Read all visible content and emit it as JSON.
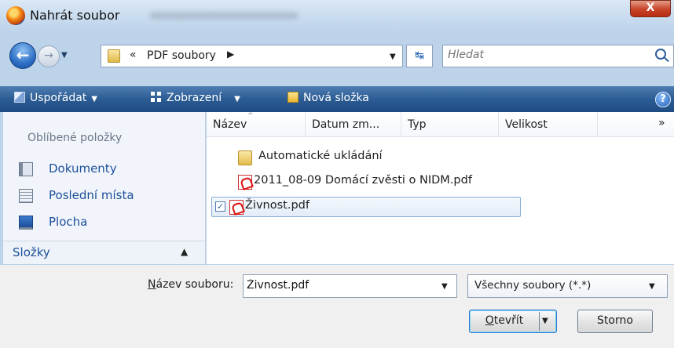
{
  "window": {
    "title": "Nahrát soubor",
    "close_symbol": "X"
  },
  "address": {
    "separator_left": "«",
    "path": "PDF soubory",
    "separator_right": "▶",
    "search_placeholder": "Hledat"
  },
  "toolbar": {
    "organize": "Uspořádat",
    "views": "Zobrazení",
    "new_folder": "Nová složka",
    "help": "?"
  },
  "sidebar": {
    "favorites_heading": "Oblíbené položky",
    "items": [
      {
        "label": "Dokumenty",
        "icon": "documents-icon"
      },
      {
        "label": "Poslední místa",
        "icon": "recent-places-icon"
      },
      {
        "label": "Plocha",
        "icon": "desktop-icon"
      }
    ],
    "folders_label": "Složky"
  },
  "filelist": {
    "columns": [
      "Název",
      "Datum zm...",
      "Typ",
      "Velikost"
    ],
    "more_columns": "»",
    "rows": [
      {
        "name": "Automatické ukládání",
        "type": "folder",
        "selected": false
      },
      {
        "name": "2011_08-09 Domácí zvěsti o NIDM.pdf",
        "type": "pdf",
        "selected": false
      },
      {
        "name": "Živnost.pdf",
        "type": "pdf",
        "selected": true
      }
    ]
  },
  "footer": {
    "filename_label_prefix": "N",
    "filename_label_rest": "ázev souboru:",
    "filename_value": "Živnost.pdf",
    "filetype_value": "Všechny soubory (*.*)",
    "open_label_prefix": "O",
    "open_label_rest": "tevřít",
    "cancel_label": "Storno"
  },
  "colors": {
    "toolbar": "#2b5c93",
    "link": "#1d4f9c",
    "selection_border": "#86aad6"
  }
}
